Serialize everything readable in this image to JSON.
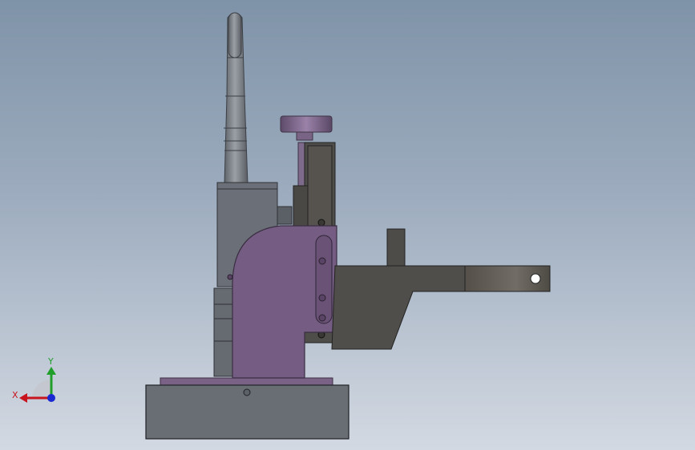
{
  "viewport": {
    "colors": {
      "background_top": "#7f93a8",
      "background_bottom": "#d3d9e2",
      "purple_part": "#745c82",
      "dark_part": "#504e4a",
      "gray_part": "#6a6e76",
      "metal": "#7e8286"
    }
  },
  "triad": {
    "x_label": "X",
    "y_label": "Y",
    "x_color": "#c8141e",
    "y_color": "#1f9e2a",
    "z_color": "#1a28d2"
  }
}
